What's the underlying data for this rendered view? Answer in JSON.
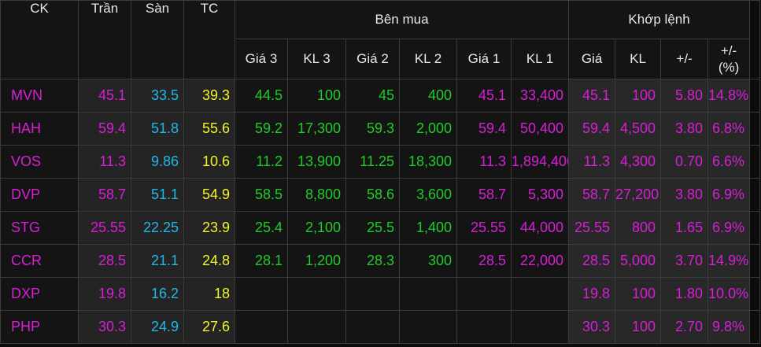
{
  "header": {
    "ck": "CK",
    "tran": "Trần",
    "san": "Sàn",
    "tc": "TC",
    "ben_mua": "Bên mua",
    "khop_lenh": "Khớp lệnh",
    "gia3": "Giá 3",
    "kl3": "KL 3",
    "gia2": "Giá 2",
    "kl2": "KL 2",
    "gia1": "Giá 1",
    "kl1": "KL 1",
    "gia": "Giá",
    "kl": "KL",
    "change": "+/-",
    "change_pct_line1": "+/-",
    "change_pct_line2": "(%)",
    "extra": "("
  },
  "colors": {
    "ceiling": "#d71fd6",
    "floor": "#1fb8ea",
    "reference": "#f4f426",
    "up": "#1fcc2a"
  },
  "rows": [
    {
      "ck": "MVN",
      "tran": "45.1",
      "san": "33.5",
      "tc": "39.3",
      "gia3": "44.5",
      "kl3": "100",
      "gia2": "45",
      "kl2": "400",
      "gia1": "45.1",
      "kl1": "33,400",
      "gia": "45.1",
      "kl": "100",
      "change": "5.80",
      "pct": "14.8%"
    },
    {
      "ck": "HAH",
      "tran": "59.4",
      "san": "51.8",
      "tc": "55.6",
      "gia3": "59.2",
      "kl3": "17,300",
      "gia2": "59.3",
      "kl2": "2,000",
      "gia1": "59.4",
      "kl1": "50,400",
      "gia": "59.4",
      "kl": "4,500",
      "change": "3.80",
      "pct": "6.8%"
    },
    {
      "ck": "VOS",
      "tran": "11.3",
      "san": "9.86",
      "tc": "10.6",
      "gia3": "11.2",
      "kl3": "13,900",
      "gia2": "11.25",
      "kl2": "18,300",
      "gia1": "11.3",
      "kl1": "1,894,400",
      "gia": "11.3",
      "kl": "4,300",
      "change": "0.70",
      "pct": "6.6%"
    },
    {
      "ck": "DVP",
      "tran": "58.7",
      "san": "51.1",
      "tc": "54.9",
      "gia3": "58.5",
      "kl3": "8,800",
      "gia2": "58.6",
      "kl2": "3,600",
      "gia1": "58.7",
      "kl1": "5,300",
      "gia": "58.7",
      "kl": "27,200",
      "change": "3.80",
      "pct": "6.9%"
    },
    {
      "ck": "STG",
      "tran": "25.55",
      "san": "22.25",
      "tc": "23.9",
      "gia3": "25.4",
      "kl3": "2,100",
      "gia2": "25.5",
      "kl2": "1,400",
      "gia1": "25.55",
      "kl1": "44,000",
      "gia": "25.55",
      "kl": "800",
      "change": "1.65",
      "pct": "6.9%"
    },
    {
      "ck": "CCR",
      "tran": "28.5",
      "san": "21.1",
      "tc": "24.8",
      "gia3": "28.1",
      "kl3": "1,200",
      "gia2": "28.3",
      "kl2": "300",
      "gia1": "28.5",
      "kl1": "22,000",
      "gia": "28.5",
      "kl": "5,000",
      "change": "3.70",
      "pct": "14.9%"
    },
    {
      "ck": "DXP",
      "tran": "19.8",
      "san": "16.2",
      "tc": "18",
      "gia3": "",
      "kl3": "",
      "gia2": "",
      "kl2": "",
      "gia1": "",
      "kl1": "",
      "gia": "19.8",
      "kl": "100",
      "change": "1.80",
      "pct": "10.0%"
    },
    {
      "ck": "PHP",
      "tran": "30.3",
      "san": "24.9",
      "tc": "27.6",
      "gia3": "",
      "kl3": "",
      "gia2": "",
      "kl2": "",
      "gia1": "",
      "kl1": "",
      "gia": "30.3",
      "kl": "100",
      "change": "2.70",
      "pct": "9.8%"
    }
  ]
}
